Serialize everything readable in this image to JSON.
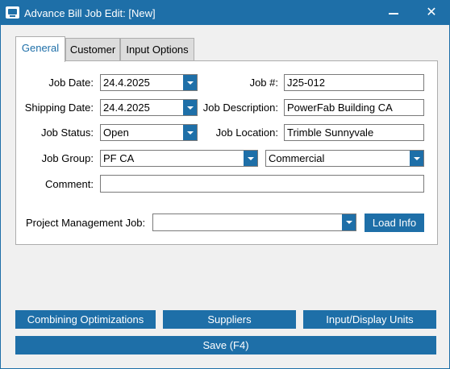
{
  "window": {
    "title": "Advance Bill Job Edit:  [New]",
    "minimize_icon": "minimize-icon",
    "close_icon": "close-icon",
    "close_glyph": "✕"
  },
  "tabs": [
    {
      "label": "General",
      "active": true
    },
    {
      "label": "Customer",
      "active": false
    },
    {
      "label": "Input Options",
      "active": false
    }
  ],
  "general": {
    "job_date": {
      "label": "Job Date:",
      "value": "24.4.2025"
    },
    "shipping_date": {
      "label": "Shipping Date:",
      "value": "24.4.2025"
    },
    "job_status": {
      "label": "Job Status:",
      "value": "Open"
    },
    "job_group": {
      "label": "Job Group:",
      "value": "PF CA",
      "secondary_value": "Commercial"
    },
    "job_number": {
      "label": "Job #:",
      "value": "J25-012"
    },
    "job_description": {
      "label": "Job Description:",
      "value": "PowerFab Building CA"
    },
    "job_location": {
      "label": "Job Location:",
      "value": "Trimble Sunnyvale"
    },
    "comment": {
      "label": "Comment:",
      "value": ""
    },
    "project_management_job": {
      "label": "Project Management Job:",
      "value": ""
    },
    "load_info_label": "Load Info"
  },
  "buttons": {
    "combining_optimizations": "Combining Optimizations",
    "suppliers": "Suppliers",
    "input_display_units": "Input/Display Units",
    "save": "Save (F4)"
  },
  "colors": {
    "accent": "#1e6fa8",
    "window_bg": "#f0f0f0"
  }
}
